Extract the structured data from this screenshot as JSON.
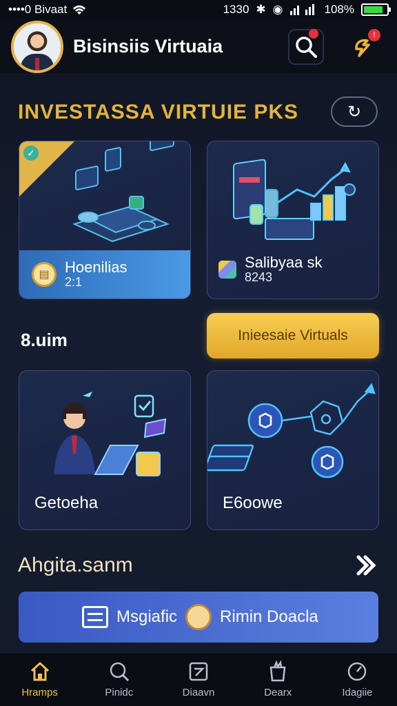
{
  "status_bar": {
    "carrier": "••••0 Bivaat",
    "time": "1330",
    "battery": "108%"
  },
  "header": {
    "title": "Bisinsiis Virtuaia",
    "notification_count": "!"
  },
  "section": {
    "title": "INVESTASSA VIRTUIE PKS",
    "refresh_symbol": "↻"
  },
  "cards": [
    {
      "title": "Hoenilias",
      "value": "2:1"
    },
    {
      "title": "Salibyaa sk",
      "value": "8243"
    },
    {
      "title": "Getoeha"
    },
    {
      "title": "E6oowe"
    }
  ],
  "amount": "8.uim",
  "cta_label": "Inieesaie Virtuals",
  "subsection_title": "Ahgita.sanm",
  "banner": {
    "left_text": "Msgiafic",
    "right_text": "Rimin Doacla"
  },
  "tabs": [
    {
      "label": "Hramps",
      "icon": "home-icon",
      "active": true
    },
    {
      "label": "Pinidc",
      "icon": "search-icon",
      "active": false
    },
    {
      "label": "Diaavn",
      "icon": "wallet-icon",
      "active": false
    },
    {
      "label": "Dearx",
      "icon": "bag-icon",
      "active": false
    },
    {
      "label": "Idagiie",
      "icon": "gauge-icon",
      "active": false
    }
  ],
  "colors": {
    "accent_gold": "#e4b43b",
    "background": "#131a2b",
    "card_blue": "#4a9ae6"
  }
}
